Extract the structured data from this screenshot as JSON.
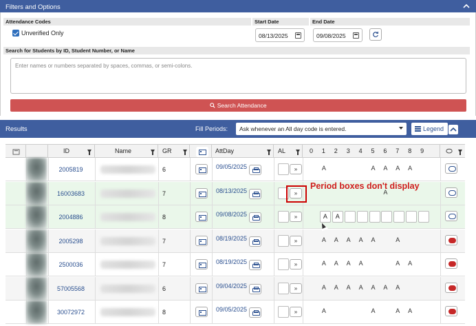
{
  "filters": {
    "title": "Filters and Options",
    "attendance_codes_label": "Attendance Codes",
    "unverified_label": "Unverified Only",
    "start_date_label": "Start Date",
    "start_date": "08/13/2025",
    "end_date_label": "End Date",
    "end_date": "09/08/2025",
    "search_label": "Search for Students by ID, Student Number, or Name",
    "search_placeholder": "Enter names or numbers separated by spaces, commas, or semi-colons.",
    "search_button": "Search Attendance",
    "search_button_color": "#cf5353"
  },
  "results": {
    "title": "Results",
    "fill_periods_label": "Fill Periods:",
    "fill_periods_value": "Ask whenever an All day code is entered.",
    "legend_label": "Legend",
    "header_color": "#3f5e9f"
  },
  "columns": {
    "id": "ID",
    "name": "Name",
    "gr": "GR",
    "attday": "AttDay",
    "al": "AL",
    "periods": [
      "0",
      "1",
      "2",
      "3",
      "4",
      "5",
      "6",
      "7",
      "8",
      "9"
    ]
  },
  "rows": [
    {
      "id": "2005819",
      "gr": "6",
      "attday": "09/05/2025",
      "codes": [
        "",
        "A",
        "",
        "",
        "",
        "A",
        "A",
        "A",
        "A",
        ""
      ],
      "comment": "normal",
      "style": "white"
    },
    {
      "id": "16003683",
      "gr": "7",
      "attday": "08/13/2025",
      "codes": [
        "",
        "",
        "",
        "",
        "",
        "",
        "A",
        "",
        "",
        ""
      ],
      "comment": "normal",
      "style": "green"
    },
    {
      "id": "2004886",
      "gr": "8",
      "attday": "09/08/2025",
      "codes": [
        "",
        "A",
        "A",
        "",
        "",
        "",
        "",
        "",
        "",
        ""
      ],
      "comment": "normal",
      "style": "green",
      "boxes": true
    },
    {
      "id": "2005298",
      "gr": "7",
      "attday": "08/19/2025",
      "codes": [
        "",
        "A",
        "A",
        "A",
        "A",
        "A",
        "",
        "A",
        "",
        ""
      ],
      "comment": "red",
      "style": "gray"
    },
    {
      "id": "2500036",
      "gr": "7",
      "attday": "08/19/2025",
      "codes": [
        "",
        "A",
        "A",
        "A",
        "A",
        "",
        "",
        "A",
        "A",
        ""
      ],
      "comment": "red",
      "style": "white"
    },
    {
      "id": "57005568",
      "gr": "6",
      "attday": "09/04/2025",
      "codes": [
        "",
        "A",
        "A",
        "A",
        "A",
        "A",
        "A",
        "A",
        "",
        ""
      ],
      "comment": "red",
      "style": "gray"
    },
    {
      "id": "30072972",
      "gr": "8",
      "attday": "09/05/2025",
      "codes": [
        "",
        "A",
        "",
        "",
        "",
        "A",
        "",
        "A",
        "A",
        ""
      ],
      "comment": "red",
      "style": "white"
    }
  ],
  "annotation": {
    "text": "Period boxes don't display",
    "color": "#d01d1d"
  },
  "icons": {
    "collapse": "chevron-up-icon",
    "calendar": "calendar-icon",
    "refresh": "refresh-icon",
    "search": "search-icon",
    "legend": "list-icon",
    "filter": "funnel-icon",
    "card": "id-card-icon",
    "print": "printer-icon",
    "next": "double-chevron-right-icon",
    "comment": "comment-icon"
  }
}
